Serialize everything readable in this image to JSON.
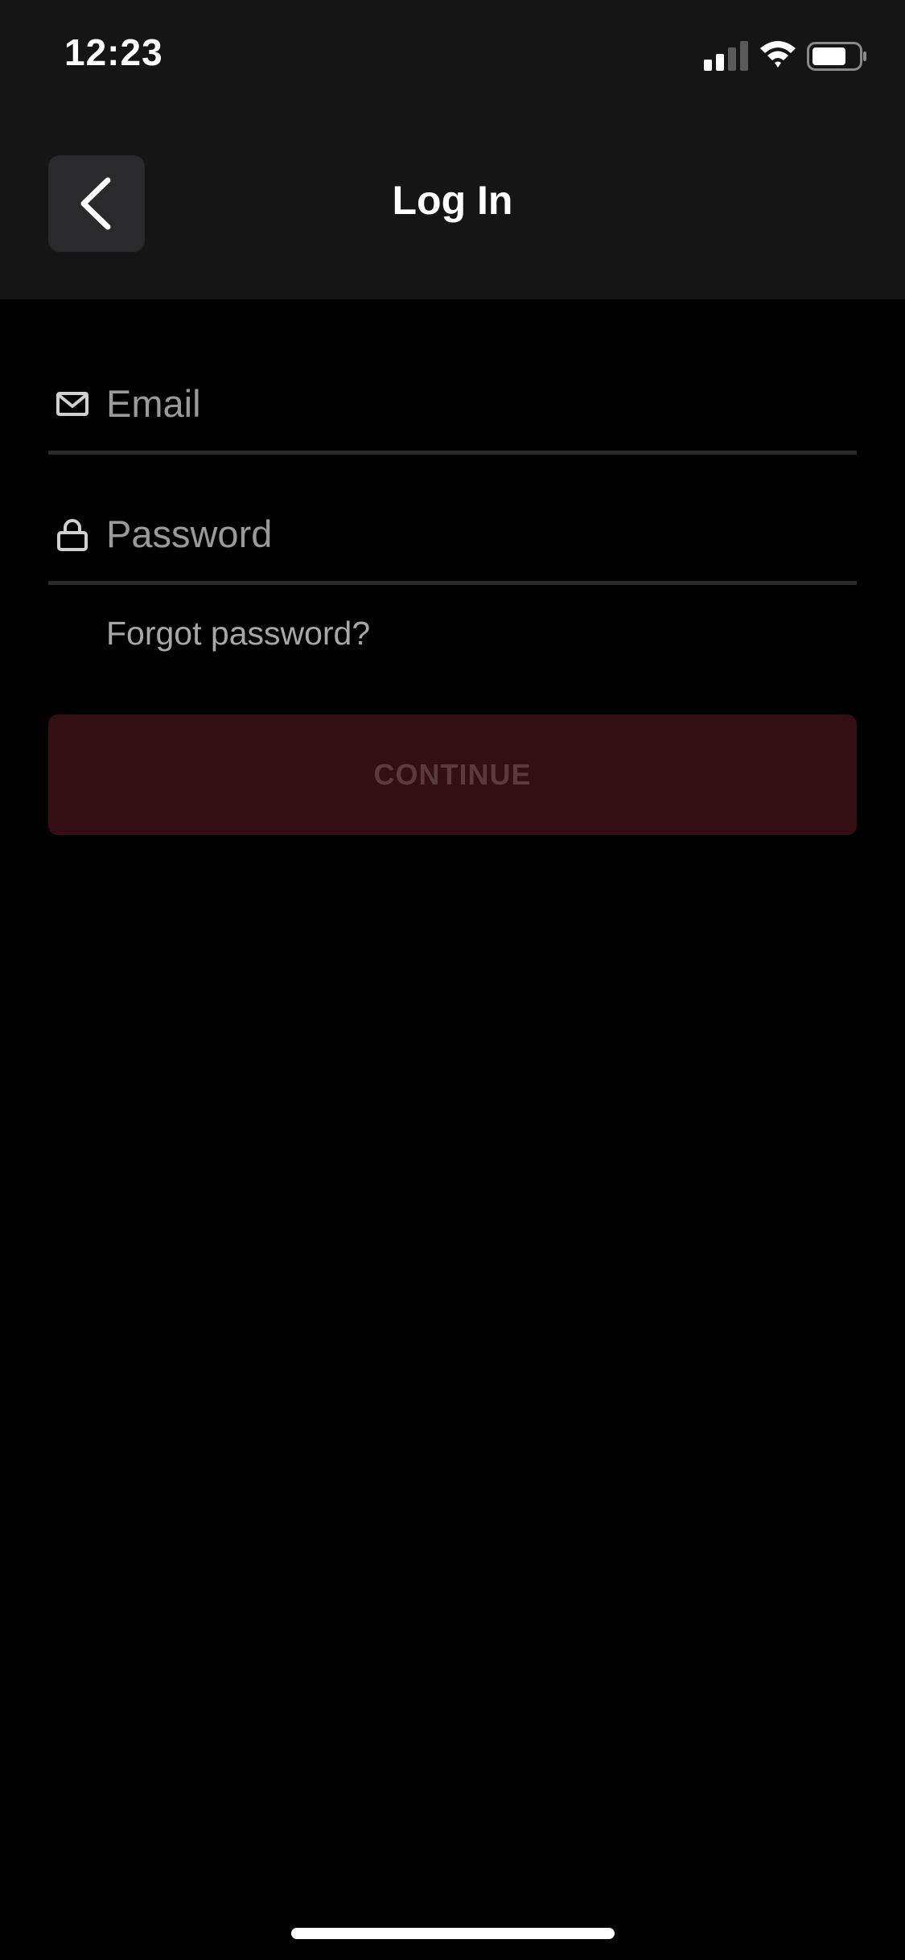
{
  "status_bar": {
    "time": "12:23",
    "icons": [
      "cellular-signal-icon",
      "wifi-icon",
      "battery-icon"
    ],
    "battery_level": 0.7
  },
  "header": {
    "title": "Log In",
    "back_icon": "chevron-left-icon"
  },
  "form": {
    "email": {
      "icon": "mail-icon",
      "placeholder": "Email",
      "value": ""
    },
    "password": {
      "icon": "lock-icon",
      "placeholder": "Password",
      "value": ""
    },
    "forgot_password_label": "Forgot password?",
    "continue_label": "CONTINUE",
    "continue_enabled": false
  },
  "colors": {
    "background": "#000000",
    "header_background": "#151515",
    "button_disabled_background": "#330e14",
    "button_disabled_text": "#5a3a3e",
    "placeholder_text": "#9a9a9a",
    "field_underline": "#2b2b2d"
  }
}
